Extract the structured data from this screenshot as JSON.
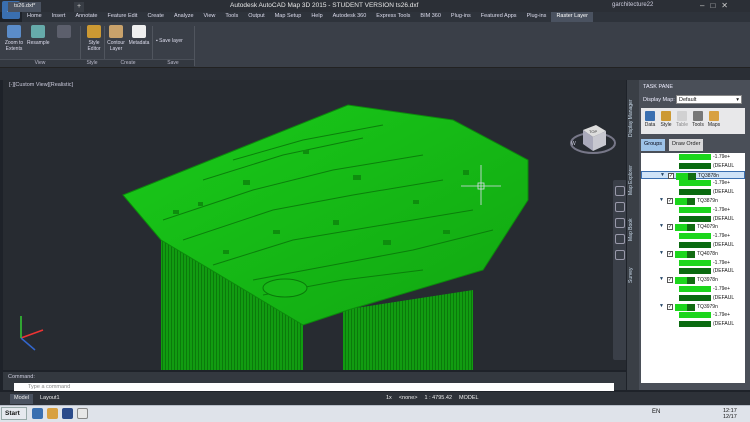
{
  "title": "Autodesk AutoCAD Map 3D 2015 - STUDENT VERSION   ts26.dxf",
  "user": "garchitecture22",
  "app_button": "A",
  "menu": [
    "Home",
    "Insert",
    "Annotate",
    "Feature Edit",
    "Create",
    "Analyze",
    "View",
    "Tools",
    "Output",
    "Map Setup",
    "Help",
    "Autodesk 360",
    "Express Tools",
    "BIM 360",
    "Plug-ins",
    "Featured Apps",
    "Plug-ins",
    "Raster Layer"
  ],
  "ribbon": {
    "zoom_to_extents": "Zoom to Extents",
    "resample": "Resample",
    "style_editor": "Style Editor",
    "contour_layer": "Contour Layer",
    "metadata": "Metadata",
    "save_layer": "Save layer",
    "groups": {
      "view": "View",
      "style": "Style",
      "create": "Create",
      "save": "Save"
    }
  },
  "doc_tab": "ts26.dxf*",
  "viewport_label": "[-][Custom View][Realistic]",
  "viewcube": {
    "top": "TOP",
    "compass": "W"
  },
  "task_pane": {
    "title": "TASK PANE",
    "display_map_label": "Display Map:",
    "display_map_value": "Default",
    "side_tabs": [
      "Display Manager",
      "Map Explorer",
      "Map Book",
      "Survey"
    ],
    "tools": [
      "Data",
      "Style",
      "Table",
      "Tools",
      "Maps"
    ],
    "tabs": [
      "Groups",
      "Draw Order"
    ]
  },
  "layers": [
    {
      "kind": "sw",
      "text": "-1.79e+"
    },
    {
      "kind": "dark",
      "text": "(DEFAUL"
    },
    {
      "kind": "head",
      "text": "TQ3878n",
      "sel": true
    },
    {
      "kind": "sw",
      "text": "-1.79e+"
    },
    {
      "kind": "dark",
      "text": "(DEFAUL"
    },
    {
      "kind": "head",
      "text": "TQ3879n"
    },
    {
      "kind": "sw",
      "text": "-1.79e+"
    },
    {
      "kind": "dark",
      "text": "(DEFAUL"
    },
    {
      "kind": "head",
      "text": "TQ4079n"
    },
    {
      "kind": "sw",
      "text": "-1.79e+"
    },
    {
      "kind": "dark",
      "text": "(DEFAUL"
    },
    {
      "kind": "head",
      "text": "TQ4078n"
    },
    {
      "kind": "sw",
      "text": "-1.79e+"
    },
    {
      "kind": "dark",
      "text": "(DEFAUL"
    },
    {
      "kind": "head",
      "text": "TQ3978n"
    },
    {
      "kind": "sw",
      "text": "-1.79e+"
    },
    {
      "kind": "dark",
      "text": "(DEFAUL"
    },
    {
      "kind": "head",
      "text": "TQ3979n"
    },
    {
      "kind": "sw",
      "text": "-1.79e+"
    },
    {
      "kind": "dark",
      "text": "(DEFAUL"
    }
  ],
  "command": {
    "label": "Command:",
    "placeholder": "Type a command"
  },
  "status": {
    "model_tab": "Model",
    "layout_tab": "Layout1",
    "annoscale": "1x",
    "workspace": "<none>",
    "scale": "1 : 4795.42",
    "model": "MODEL"
  },
  "taskbar": {
    "start": "Start",
    "lang": "EN",
    "time": "12:17",
    "date": "12/17"
  }
}
